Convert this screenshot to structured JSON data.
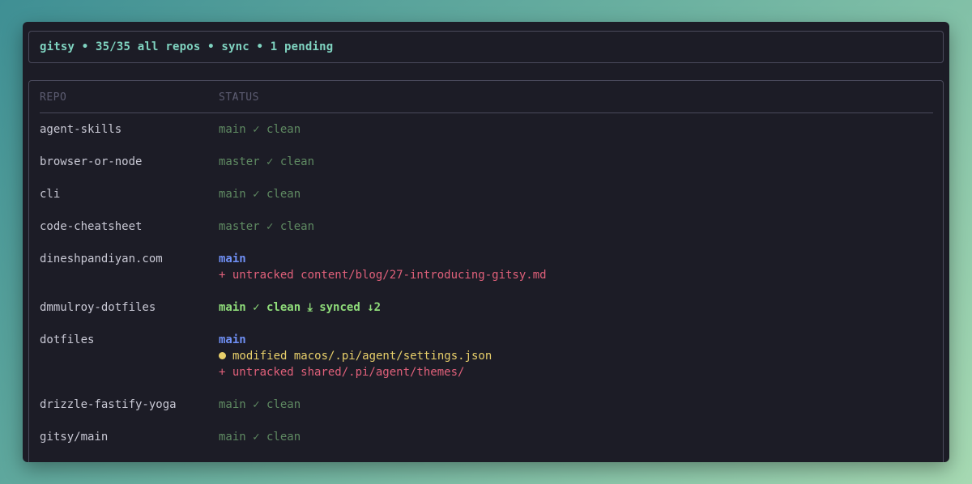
{
  "header": {
    "title": "gitsy • 35/35 all repos • sync • 1 pending"
  },
  "table": {
    "columns": [
      "REPO",
      "STATUS"
    ],
    "rows": [
      {
        "repo": "agent-skills",
        "status": [
          "main ✓ clean"
        ]
      },
      {
        "repo": "browser-or-node",
        "status": [
          "master ✓ clean"
        ]
      },
      {
        "repo": "cli",
        "status": [
          "main ✓ clean"
        ]
      },
      {
        "repo": "code-cheatsheet",
        "status": [
          "master ✓ clean"
        ]
      },
      {
        "repo": "dineshpandiyan.com",
        "status": [
          "main",
          "+ untracked content/blog/27-introducing-gitsy.md"
        ]
      },
      {
        "repo": "dmmulroy-dotfiles",
        "status": [
          "main ✓ clean ⤓ synced ↓2"
        ]
      },
      {
        "repo": "dotfiles",
        "status": [
          "main",
          "modified macos/.pi/agent/settings.json",
          "+ untracked shared/.pi/agent/themes/"
        ]
      },
      {
        "repo": "drizzle-fastify-yoga",
        "status": [
          "main ✓ clean"
        ]
      },
      {
        "repo": "gitsy/main",
        "status": [
          "main ✓ clean"
        ]
      }
    ]
  },
  "colors": {
    "window_bg": "#1c1c26",
    "header_text": "#7fd3c0",
    "clean_dim": "#5f8a62",
    "clean_bright": "#8fdc7a",
    "branch": "#6f8ff4",
    "untracked": "#e0607a",
    "modified": "#e8cf6a"
  }
}
